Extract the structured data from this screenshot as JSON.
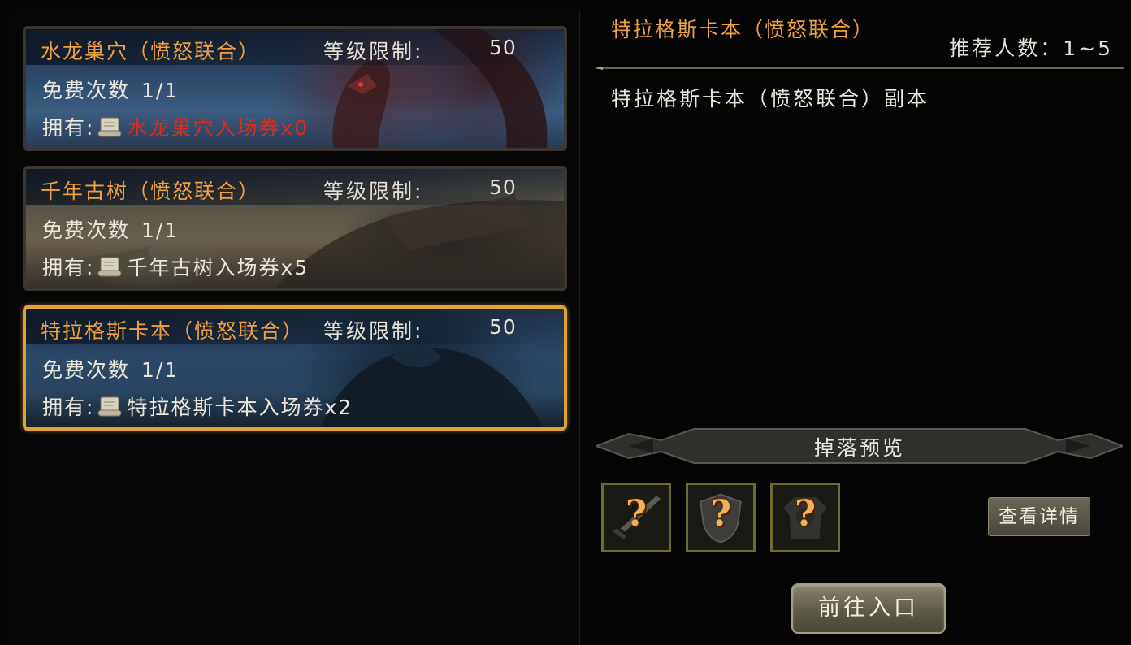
{
  "dungeons": [
    {
      "title": "水龙巢穴（愤怒联合）",
      "level_label": "等级限制:",
      "level_value": "50",
      "free_label": "免费次数",
      "free_value": "1/1",
      "own_label": "拥有:",
      "ticket": "水龙巢穴入场券x0",
      "ticket_color": "#e02a1a"
    },
    {
      "title": "千年古树（愤怒联合）",
      "level_label": "等级限制:",
      "level_value": "50",
      "free_label": "免费次数",
      "free_value": "1/1",
      "own_label": "拥有:",
      "ticket": "千年古树入场券x5",
      "ticket_color": "#ece7dc"
    },
    {
      "title": "特拉格斯卡本（愤怒联合）",
      "level_label": "等级限制:",
      "level_value": "50",
      "free_label": "免费次数",
      "free_value": "1/1",
      "own_label": "拥有:",
      "ticket": "特拉格斯卡本入场券x2",
      "ticket_color": "#ece7dc",
      "selected": true
    }
  ],
  "detail": {
    "title": "特拉格斯卡本（愤怒联合）",
    "recommend": "推荐人数：1~5",
    "description": "特拉格斯卡本（愤怒联合）副本",
    "drop_preview_label": "掉落预览",
    "drop_items": [
      {
        "icon": "sword-icon",
        "mark": "?"
      },
      {
        "icon": "shield-icon",
        "mark": "?"
      },
      {
        "icon": "armor-icon",
        "mark": "?"
      }
    ],
    "details_button": "查看详情",
    "goto_button": "前往入口"
  },
  "colors": {
    "title_orange": "#f0a040",
    "selected_border": "#e0a235",
    "ticket_missing_red": "#e02a1a"
  }
}
